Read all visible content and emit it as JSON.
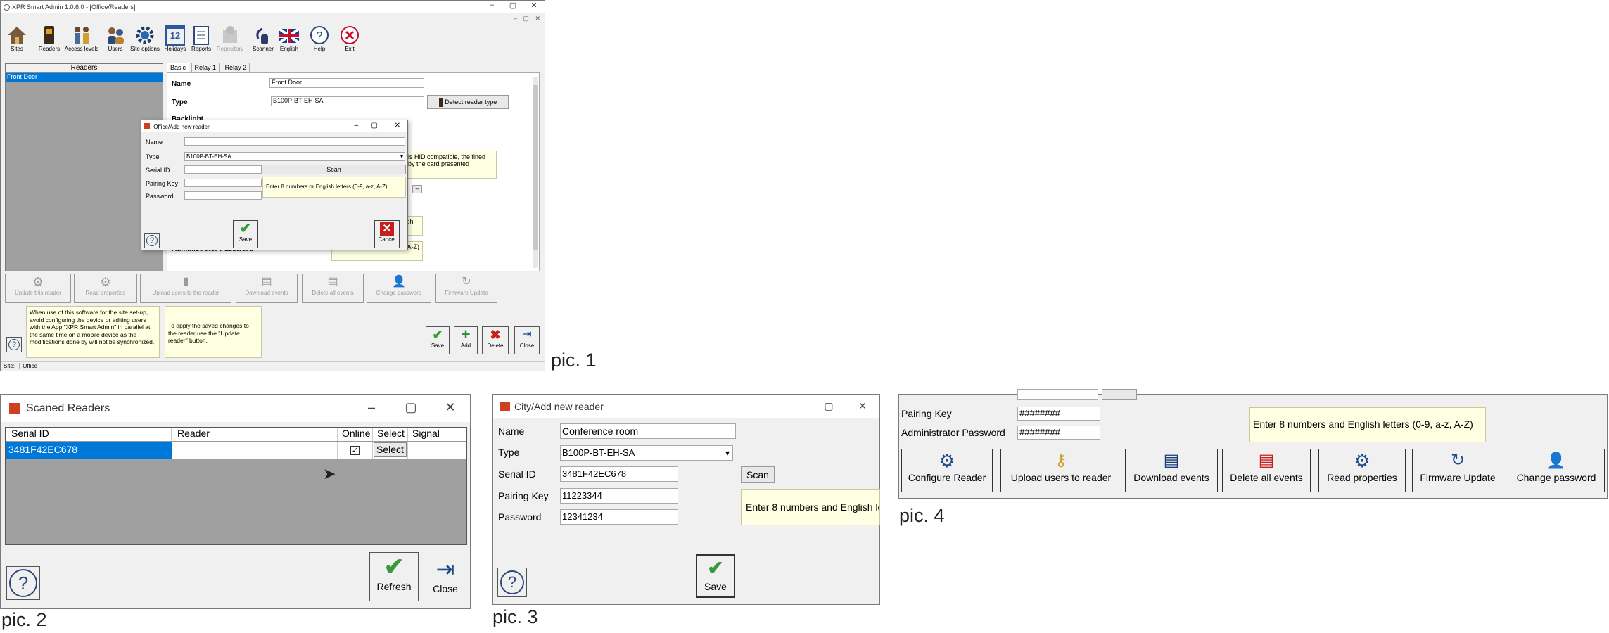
{
  "captions": {
    "pic1": "pic. 1",
    "pic2": "pic. 2",
    "pic3": "pic. 3",
    "pic4": "pic. 4"
  },
  "pic1": {
    "title": "XPR Smart Admin 1.0.6.0 - [Office/Readers]",
    "toolbar": [
      "Sites",
      "Readers",
      "Access levels",
      "Users",
      "Site options",
      "Holidays",
      "Reports",
      "Repository",
      "Scanner",
      "English",
      "Help",
      "Exit"
    ],
    "holiday_number": "12",
    "readers_header": "Readers",
    "readers": [
      "Front Door"
    ],
    "tabs": [
      "Basic",
      "Relay 1",
      "Relay 2"
    ],
    "name_label": "Name",
    "name_value": "Front Door",
    "type_label": "Type",
    "type_value": "B100P-BT-EH-SA",
    "detect_button": "Detect reader type",
    "backlight_label": "Backlight",
    "bg_tip": "is HID compatible, the fined by the card presented",
    "bg_small_tip1": "lish",
    "bg_small_tip2": "lish letters (0-9, a-z, A-Z)",
    "admin_password_label": "Administrator Password",
    "dialog": {
      "title": "Office/Add new reader",
      "name_label": "Name",
      "type_label": "Type",
      "type_value": "B100P-BT-EH-SA",
      "serial_label": "Serial ID",
      "pairing_label": "Pairing Key",
      "password_label": "Password",
      "scan_button": "Scan",
      "tip": "Enter 8 numbers or English letters (0-9, a-z, A-Z)",
      "save_button": "Save",
      "cancel_button": "Cancel"
    },
    "action_buttons": [
      "Update this reader",
      "Read properties",
      "Upload users to the reader",
      "Download events",
      "Delete all events",
      "Change password",
      "Firmware Update"
    ],
    "info_tip": "When use of this software for the site set-up, avoid configuring the device or editing users with the App \"XPR Smart Admin\" in parallel at the same time on a mobile device as the modifications done by will not be synchronized.",
    "apply_tip": "To apply the saved changes to the reader use the \"Update reader\" button.",
    "bottom_buttons": [
      "Save",
      "Add",
      "Delete",
      "Close"
    ],
    "status_site_label": "Site:",
    "status_site_value": "Office"
  },
  "pic2": {
    "title": "Scaned Readers",
    "columns": [
      "Serial ID",
      "Reader",
      "Online",
      "Select",
      "Signal"
    ],
    "rows": [
      {
        "serial": "3481F42EC678",
        "reader": "",
        "online": true,
        "select": "Select",
        "signal": ""
      }
    ],
    "refresh_button": "Refresh",
    "close_button": "Close"
  },
  "pic3": {
    "title": "City/Add new reader",
    "name_label": "Name",
    "name_value": "Conference room",
    "type_label": "Type",
    "type_value": "B100P-BT-EH-SA",
    "serial_label": "Serial ID",
    "serial_value": "3481F42EC678",
    "pairing_label": "Pairing Key",
    "pairing_value": "11223344",
    "password_label": "Password",
    "password_value": "12341234",
    "scan_button": "Scan",
    "tip": "Enter 8 numbers and English le",
    "save_button": "Save"
  },
  "pic4": {
    "pairing_label": "Pairing Key",
    "pairing_value": "########",
    "admin_label": "Administrator Password",
    "admin_value": "########",
    "tip": "Enter 8 numbers and English letters (0-9, a-z, A-Z)",
    "buttons": [
      "Configure Reader",
      "Upload users to reader",
      "Download events",
      "Delete all events",
      "Read properties",
      "Firmware Update",
      "Change password"
    ]
  }
}
